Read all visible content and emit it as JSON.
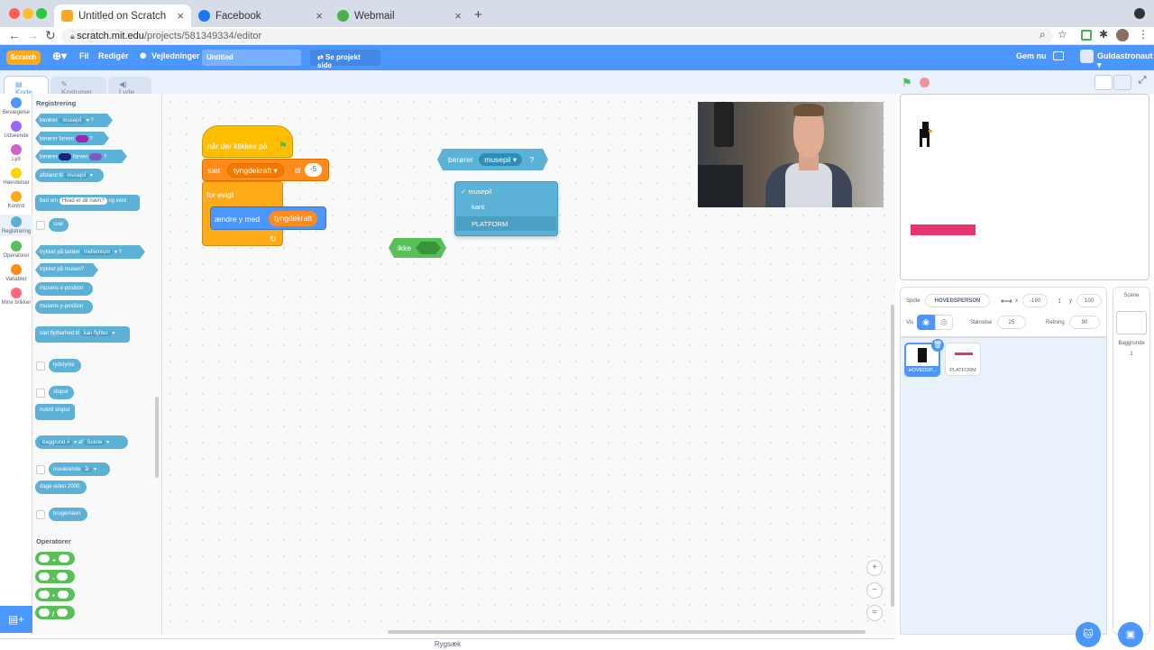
{
  "browser": {
    "tabs": [
      {
        "label": "Untitled on Scratch",
        "active": true
      },
      {
        "label": "Facebook",
        "active": false
      },
      {
        "label": "Webmail",
        "active": false
      }
    ],
    "url_host": "scratch.mit.edu",
    "url_path": "/projects/581349334/editor"
  },
  "menu": {
    "logo": "Scratch",
    "file": "Fil",
    "edit": "Redigér",
    "tutorials": "Vejledninger",
    "project_title": "Untitled",
    "see_project": "Se projekt side",
    "save_now": "Gem nu",
    "username": "Guldastronaut"
  },
  "editor_tabs": [
    "Kode",
    "Kostumer",
    "Lyde"
  ],
  "categories": [
    {
      "label": "Bevægelse",
      "color": "#4c97ff"
    },
    {
      "label": "Udseende",
      "color": "#9966ff"
    },
    {
      "label": "Lyd",
      "color": "#cf63cf"
    },
    {
      "label": "Hændelser",
      "color": "#ffd500"
    },
    {
      "label": "Kontrol",
      "color": "#ffab19"
    },
    {
      "label": "Registrering",
      "color": "#5cb1d6"
    },
    {
      "label": "Operatorer",
      "color": "#59c059"
    },
    {
      "label": "Variabler",
      "color": "#ff8c1a"
    },
    {
      "label": "Mine brikker",
      "color": "#ff6680"
    }
  ],
  "palette": {
    "section": "Registrering",
    "touching": "berører",
    "touching_opt": "musepil",
    "touching_color": "berører farven",
    "color_touching": "berører",
    "color_word": "farven",
    "distance": "afstand til",
    "distance_opt": "musepil",
    "ask": "bed om",
    "ask_default": "Hvad er dit navn?",
    "ask_wait": "og vent",
    "answer": "svar",
    "key_pressed": "trykket på tasten",
    "key_opt": "mellemrum",
    "mouse_down": "trykket på musen?",
    "mouse_x": "musens x-position",
    "mouse_y": "musens y-position",
    "drag_mode": "sæt flytbarhed til",
    "drag_opt": "kan flyttes",
    "loudness": "lydstyrke",
    "timer": "stopur",
    "reset_timer": "nulstil stopur",
    "backdrop_of": "baggrund #",
    "of": "af",
    "of_opt": "Scene",
    "current": "nuværende",
    "current_opt": "år",
    "days_since": "dage siden 2000",
    "username": "brugernavn",
    "operators": "Operatorer",
    "op_symbols": [
      "+",
      "-",
      "*",
      "/"
    ]
  },
  "script": {
    "hat": "når der klikkes på",
    "set": "sæt",
    "set_var": "tyngdekraft",
    "to": "til",
    "set_val": "-5",
    "forever": "for evigt",
    "change_y": "ændre y med",
    "change_var": "tyngdekraft"
  },
  "floating": {
    "touching": "berører",
    "touching_sel": "musepil",
    "q": "?",
    "not": "ikke"
  },
  "dropdown": {
    "options": [
      "musepil",
      "kant",
      "PLATFORM"
    ],
    "selected": "musepil"
  },
  "sprite_info": {
    "sprite_label": "Sprite",
    "sprite_name": "HOVEDSPERSON",
    "x_label": "x",
    "x": "-190",
    "y_label": "y",
    "y": "100",
    "show_label": "Vis",
    "size_label": "Størrelse",
    "size": "25",
    "direction_label": "Retning",
    "direction": "90"
  },
  "sprites": [
    {
      "name": "HOVEDSP...",
      "selected": true
    },
    {
      "name": "PLATFORM",
      "selected": false
    }
  ],
  "scene": {
    "title": "Scene",
    "backdrops_label": "Baggrunde",
    "backdrops_count": "1"
  },
  "backpack": "Rygsæk",
  "colors": {
    "scratch_blue": "#4c97ff",
    "sensing": "#5cb1d6",
    "control": "#ffab19",
    "events": "#ffbf00",
    "variables": "#ff8c1a",
    "operators": "#59c059",
    "platform": "#e8336c"
  }
}
